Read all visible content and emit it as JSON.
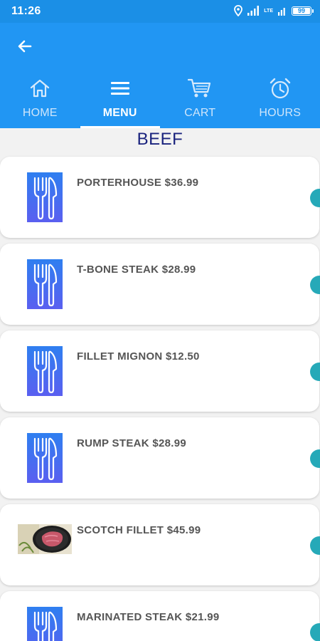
{
  "status_bar": {
    "time": "11:26",
    "network_label": "LTE",
    "battery_level": "99",
    "icons": [
      "location-icon",
      "signal-icon",
      "signal-icon",
      "battery-icon"
    ]
  },
  "app_bar": {
    "back_icon": "arrow-left-icon",
    "tabs": [
      {
        "label": "HOME",
        "icon": "home-icon",
        "active": false
      },
      {
        "label": "MENU",
        "icon": "menu-icon",
        "active": true
      },
      {
        "label": "CART",
        "icon": "cart-icon",
        "active": false
      },
      {
        "label": "HOURS",
        "icon": "alarm-clock-icon",
        "active": false
      }
    ]
  },
  "section": {
    "title": "BEEF"
  },
  "menu_items": [
    {
      "name": "PORTERHOUSE $36.99",
      "image": "cutlery-icon"
    },
    {
      "name": "T-BONE STEAK $28.99",
      "image": "cutlery-icon"
    },
    {
      "name": "FILLET MIGNON $12.50",
      "image": "cutlery-icon"
    },
    {
      "name": "RUMP STEAK $28.99",
      "image": "cutlery-icon"
    },
    {
      "name": "SCOTCH FILLET $45.99",
      "image": "steak-photo"
    },
    {
      "name": "MARINATED STEAK $21.99",
      "image": "cutlery-icon"
    }
  ],
  "colors": {
    "status_bar": "#1b8fe6",
    "app_bar": "#2196f3",
    "section_title": "#1a237e",
    "add_button": "#26a9b8",
    "item_text": "#555555"
  }
}
